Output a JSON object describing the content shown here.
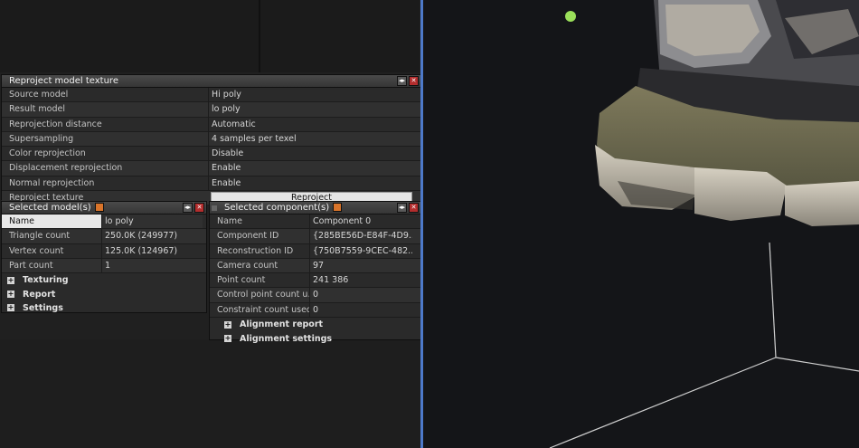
{
  "reproject_panel": {
    "title": "Reproject model texture",
    "rows": [
      {
        "label": "Source model",
        "value": "Hi poly"
      },
      {
        "label": "Result model",
        "value": "lo poly"
      },
      {
        "label": "Reprojection distance",
        "value": "Automatic"
      },
      {
        "label": "Supersampling",
        "value": "4 samples per texel"
      },
      {
        "label": "Color reprojection",
        "value": "Disable"
      },
      {
        "label": "Displacement reprojection",
        "value": "Enable"
      },
      {
        "label": "Normal reprojection",
        "value": "Enable"
      }
    ],
    "action_label": "Reproject texture",
    "action_button": "Reproject"
  },
  "models_panel": {
    "title": "Selected model(s)",
    "rows": [
      {
        "label": "Name",
        "value": "lo poly"
      },
      {
        "label": "Triangle count",
        "value": "250.0K (249977)"
      },
      {
        "label": "Vertex count",
        "value": "125.0K (124967)"
      },
      {
        "label": "Part count",
        "value": "1"
      }
    ],
    "sections": [
      "Texturing",
      "Report",
      "Settings"
    ]
  },
  "components_panel": {
    "title": "Selected component(s)",
    "rows": [
      {
        "label": "Name",
        "value": "Component 0"
      },
      {
        "label": "Component ID",
        "value": "{285BE56D-E84F-4D9..."
      },
      {
        "label": "Reconstruction ID",
        "value": "{750B7559-9CEC-482..."
      },
      {
        "label": "Camera count",
        "value": "97"
      },
      {
        "label": "Point count",
        "value": "241 386"
      },
      {
        "label": "Control point count u...",
        "value": "0"
      },
      {
        "label": "Constraint count used",
        "value": "0"
      }
    ],
    "sections": [
      "Alignment report",
      "Alignment settings"
    ]
  },
  "icons": {
    "dock": "dock-icon",
    "close": "close-icon",
    "pin": "pin-icon",
    "expand": "expand-plus-icon"
  },
  "colors": {
    "accent_split": "#4d79c9",
    "close": "#b32d2d",
    "pin": "#d9742a",
    "marker": "#9be05a"
  }
}
